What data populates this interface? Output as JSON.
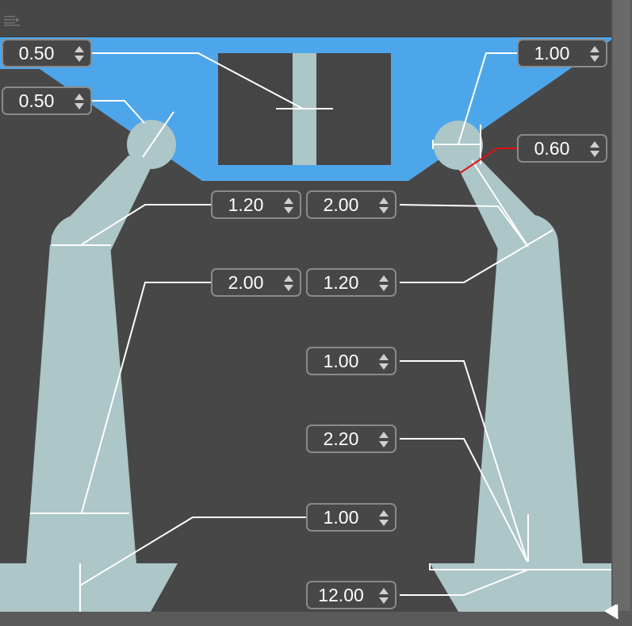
{
  "toolbar": {
    "menu_icon": "menu-lines-icon"
  },
  "colors": {
    "background": "#474747",
    "accent_blue": "#4ea6ea",
    "part_fill": "#adc6c8",
    "leader_line": "#ffffff",
    "highlight_line": "#e01010",
    "field_border": "#8a8a8a"
  },
  "fields": {
    "top_left_a": "0.50",
    "top_left_b": "0.50",
    "top_right_a": "1.00",
    "top_right_b": "0.60",
    "mid_left_a": "1.20",
    "mid_right_a": "2.00",
    "mid_left_b": "2.00",
    "mid_right_b": "1.20",
    "right_c": "1.00",
    "right_d": "2.20",
    "bottom_center": "1.00",
    "bottom_total": "12.00"
  }
}
